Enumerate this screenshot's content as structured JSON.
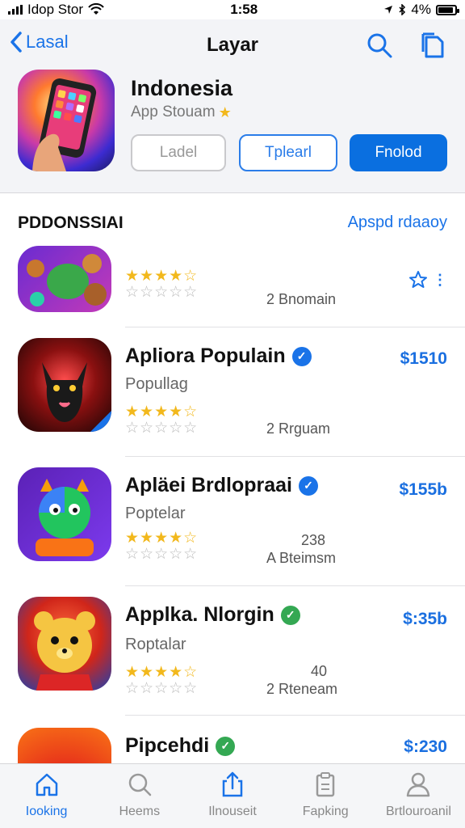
{
  "status_bar": {
    "carrier": "Idop Stor",
    "time": "1:58",
    "battery_text": "4%"
  },
  "nav": {
    "back_label": "Lasal",
    "title": "Layar"
  },
  "app": {
    "title": "Indonesia",
    "subtitle": "App Stouam",
    "buttons": {
      "label": "Ladel",
      "outline": "Tplearl",
      "primary": "Fnolod"
    }
  },
  "section": {
    "title": "PDDONSSIAI",
    "link": "Apspd rdaaoy"
  },
  "items": [
    {
      "name": "",
      "category": "",
      "meta": "2 Bnomain",
      "count": "",
      "price": "",
      "badge_color": "",
      "rating": 4.5
    },
    {
      "name": "Apliora Populain",
      "category": "Popullag",
      "meta": "2 Rrguam",
      "count": "",
      "price": "$1510",
      "badge_color": "#1a73e8",
      "rating": 4.5
    },
    {
      "name": "Apläei Brdlopraai",
      "category": "Poptelar",
      "meta": "A Bteimsm",
      "count": "238",
      "price": "$155b",
      "badge_color": "#1a73e8",
      "rating": 4.5
    },
    {
      "name": "Applka. Nlorgin",
      "category": "Roptalar",
      "meta": "2 Rteneam",
      "count": "40",
      "price": "$:35b",
      "badge_color": "#34a853",
      "rating": 4.5
    },
    {
      "name": "Pipcehdi",
      "category": "",
      "meta": "",
      "count": "",
      "price": "$:230",
      "badge_color": "#34a853",
      "rating": 0
    }
  ],
  "tabs": [
    {
      "label": "Iooking",
      "icon": "home-icon"
    },
    {
      "label": "Heems",
      "icon": "search-icon"
    },
    {
      "label": "Ilnouseit",
      "icon": "share-icon"
    },
    {
      "label": "Fapking",
      "icon": "clipboard-icon"
    },
    {
      "label": "Brtlouroanil",
      "icon": "person-icon"
    }
  ],
  "colors": {
    "accent": "#1a73e8",
    "primary_button": "#0a6fe0",
    "star": "#f2b81c"
  }
}
